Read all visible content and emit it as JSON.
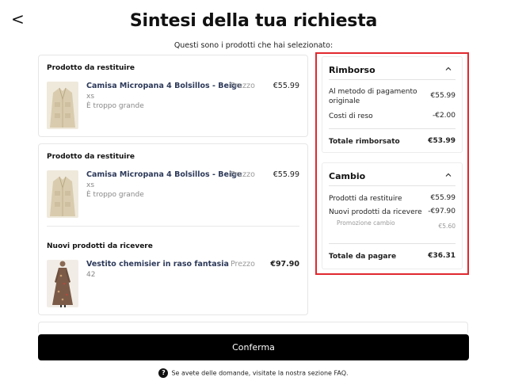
{
  "header": {
    "back_glyph": "<",
    "title": "Sintesi della tua richiesta",
    "subtitle": "Questi sono i prodotti che hai selezionato:"
  },
  "returns": [
    {
      "section_label": "Prodotto da restituire",
      "product": {
        "name": "Camisa Micropana 4 Bolsillos - Beige",
        "size": "xs",
        "reason": "È troppo grande",
        "price_label": "Prezzo",
        "price": "€55.99"
      }
    },
    {
      "section_label": "Prodotto da restituire",
      "product": {
        "name": "Camisa Micropana 4 Bolsillos - Beige",
        "size": "xs",
        "reason": "È troppo grande",
        "price_label": "Prezzo",
        "price": "€55.99"
      }
    }
  ],
  "new_products": {
    "section_label": "Nuovi prodotti da ricevere",
    "product": {
      "name": "Vestito chemisier in raso fantasia",
      "size": "42",
      "price_label": "Prezzo",
      "price": "€97.90"
    }
  },
  "refund": {
    "title": "Rimborso",
    "rows": [
      {
        "label": "Al metodo di pagamento originale",
        "value": "€55.99"
      },
      {
        "label": "Costi di reso",
        "value": "-€2.00"
      }
    ],
    "total_label": "Totale rimborsato",
    "total_value": "€53.99"
  },
  "exchange": {
    "title": "Cambio",
    "rows": [
      {
        "label": "Prodotti da restituire",
        "value": "€55.99"
      },
      {
        "label": "Nuovi prodotti da ricevere",
        "value": "-€97.90"
      }
    ],
    "promo_label": "Promozione cambio",
    "promo_value": "€5.60",
    "total_label": "Totale da pagare",
    "total_value": "€36.31"
  },
  "confirm_label": "Conferma",
  "faq_text": "Se avete delle domande, visitate la nostra sezione FAQ.",
  "faq_icon_glyph": "?",
  "colors": {
    "highlight_border": "#e0282e",
    "product_name": "#2d3a5a",
    "button_bg": "#000000"
  }
}
